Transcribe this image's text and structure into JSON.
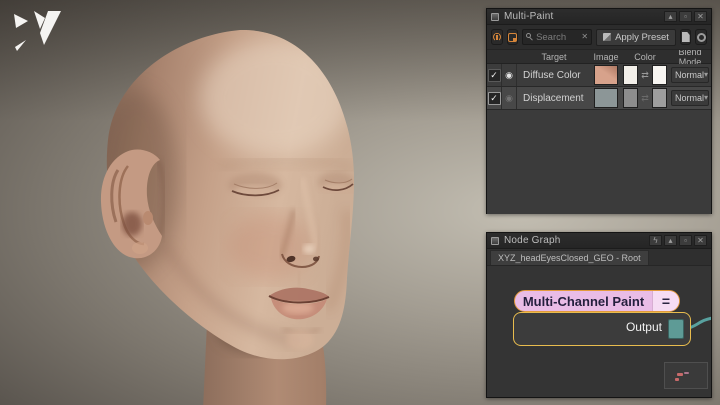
{
  "icons": {
    "checkmark": "✓",
    "eye": "◉",
    "dropdown_arrow": "▾",
    "close": "✕",
    "collapse_arrow": "▴",
    "float_window": "▫",
    "swap_arrows": "⇄",
    "lightning": "ϟ",
    "clear": "✕",
    "equals_handle": "="
  },
  "colors": {
    "accent_orange": "#d7863a",
    "node_header_pink": "#e9bce6",
    "node_handle_pink": "#f6dcf3",
    "selection_yellow": "#e8bc4e",
    "port_teal": "#5e9b96",
    "wire_teal": "#58a19f",
    "minimap_mark_red": "#c76a6a",
    "minimap_mark_pink": "#d98fae"
  },
  "multi_paint": {
    "title": "Multi-Paint",
    "toolbar": {
      "search_placeholder": "Search",
      "apply_preset_label": "Apply Preset"
    },
    "table": {
      "columns": [
        "Target",
        "Image",
        "Color",
        "Blend Mode"
      ],
      "rows": [
        {
          "enabled": true,
          "visible": true,
          "target": "Diffuse Color",
          "image_color": "#d7a28b",
          "color_primary": "#f2efe9",
          "color_secondary": "#f7f5f1",
          "blend_mode": "Normal"
        },
        {
          "enabled": true,
          "visible": false,
          "target": "Displacement",
          "image_color": "#8c9697",
          "color_primary": "#8d8d8d",
          "color_secondary": "#9e9e9e",
          "blend_mode": "Normal"
        }
      ]
    }
  },
  "node_graph": {
    "title": "Node Graph",
    "tab_label": "XYZ_headEyesClosed_GEO - Root",
    "node": {
      "title": "Multi-Channel Paint",
      "output_port_label": "Output"
    }
  }
}
